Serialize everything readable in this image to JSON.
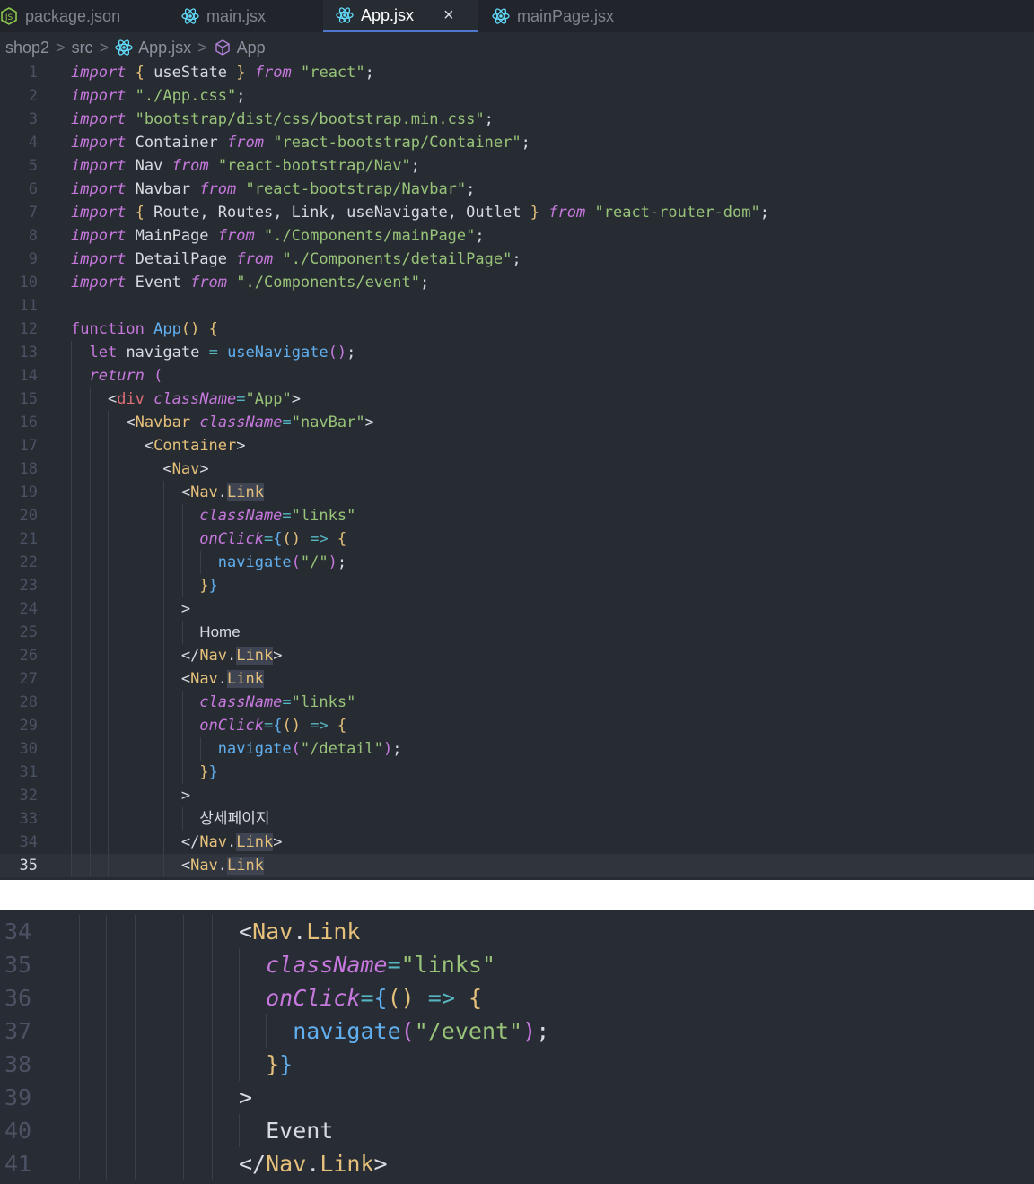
{
  "tabs": [
    {
      "label": "package.json",
      "icon": "nodejs-icon"
    },
    {
      "label": "main.jsx",
      "icon": "react-icon"
    },
    {
      "label": "App.jsx",
      "icon": "react-icon",
      "active": true,
      "close": "×"
    },
    {
      "label": "mainPage.jsx",
      "icon": "react-icon"
    }
  ],
  "breadcrumb": {
    "parts": [
      "shop2",
      "src",
      "App.jsx",
      "App"
    ],
    "separator": ">"
  },
  "editor_top": {
    "current_line": 35,
    "lines": [
      {
        "n": "1",
        "tokens": [
          [
            "kw",
            "import"
          ],
          [
            "plain",
            " "
          ],
          [
            "brk1",
            "{"
          ],
          [
            "plain",
            " useState "
          ],
          [
            "brk1",
            "}"
          ],
          [
            "plain",
            " "
          ],
          [
            "kw",
            "from"
          ],
          [
            "plain",
            " "
          ],
          [
            "str",
            "\"react\""
          ],
          [
            "plain",
            ";"
          ]
        ]
      },
      {
        "n": "2",
        "tokens": [
          [
            "kw",
            "import"
          ],
          [
            "plain",
            " "
          ],
          [
            "str",
            "\"./App.css\""
          ],
          [
            "plain",
            ";"
          ]
        ]
      },
      {
        "n": "3",
        "tokens": [
          [
            "kw",
            "import"
          ],
          [
            "plain",
            " "
          ],
          [
            "str",
            "\"bootstrap/dist/css/bootstrap.min.css\""
          ],
          [
            "plain",
            ";"
          ]
        ]
      },
      {
        "n": "4",
        "tokens": [
          [
            "kw",
            "import"
          ],
          [
            "plain",
            " Container "
          ],
          [
            "kw",
            "from"
          ],
          [
            "plain",
            " "
          ],
          [
            "str",
            "\"react-bootstrap/Container\""
          ],
          [
            "plain",
            ";"
          ]
        ]
      },
      {
        "n": "5",
        "tokens": [
          [
            "kw",
            "import"
          ],
          [
            "plain",
            " Nav "
          ],
          [
            "kw",
            "from"
          ],
          [
            "plain",
            " "
          ],
          [
            "str",
            "\"react-bootstrap/Nav\""
          ],
          [
            "plain",
            ";"
          ]
        ]
      },
      {
        "n": "6",
        "tokens": [
          [
            "kw",
            "import"
          ],
          [
            "plain",
            " Navbar "
          ],
          [
            "kw",
            "from"
          ],
          [
            "plain",
            " "
          ],
          [
            "str",
            "\"react-bootstrap/Navbar\""
          ],
          [
            "plain",
            ";"
          ]
        ]
      },
      {
        "n": "7",
        "tokens": [
          [
            "kw",
            "import"
          ],
          [
            "plain",
            " "
          ],
          [
            "brk1",
            "{"
          ],
          [
            "plain",
            " Route, Routes, Link, useNavigate, Outlet "
          ],
          [
            "brk1",
            "}"
          ],
          [
            "plain",
            " "
          ],
          [
            "kw",
            "from"
          ],
          [
            "plain",
            " "
          ],
          [
            "str",
            "\"react-router-dom\""
          ],
          [
            "plain",
            ";"
          ]
        ]
      },
      {
        "n": "8",
        "tokens": [
          [
            "kw",
            "import"
          ],
          [
            "plain",
            " MainPage "
          ],
          [
            "kw",
            "from"
          ],
          [
            "plain",
            " "
          ],
          [
            "str",
            "\"./Components/mainPage\""
          ],
          [
            "plain",
            ";"
          ]
        ]
      },
      {
        "n": "9",
        "tokens": [
          [
            "kw",
            "import"
          ],
          [
            "plain",
            " DetailPage "
          ],
          [
            "kw",
            "from"
          ],
          [
            "plain",
            " "
          ],
          [
            "str",
            "\"./Components/detailPage\""
          ],
          [
            "plain",
            ";"
          ]
        ]
      },
      {
        "n": "10",
        "tokens": [
          [
            "kw",
            "import"
          ],
          [
            "plain",
            " Event "
          ],
          [
            "kw",
            "from"
          ],
          [
            "plain",
            " "
          ],
          [
            "str",
            "\"./Components/event\""
          ],
          [
            "plain",
            ";"
          ]
        ]
      },
      {
        "n": "11",
        "tokens": []
      },
      {
        "n": "12",
        "tokens": [
          [
            "kwn",
            "function"
          ],
          [
            "plain",
            " "
          ],
          [
            "fn",
            "App"
          ],
          [
            "brk1",
            "()"
          ],
          [
            "plain",
            " "
          ],
          [
            "brk1",
            "{"
          ]
        ]
      },
      {
        "n": "13",
        "tokens": [
          [
            "plain",
            "  "
          ],
          [
            "kwn",
            "let"
          ],
          [
            "plain",
            " navigate "
          ],
          [
            "op",
            "="
          ],
          [
            "plain",
            " "
          ],
          [
            "fn",
            "useNavigate"
          ],
          [
            "brk2",
            "()"
          ],
          [
            "plain",
            ";"
          ]
        ]
      },
      {
        "n": "14",
        "tokens": [
          [
            "plain",
            "  "
          ],
          [
            "kw",
            "return"
          ],
          [
            "plain",
            " "
          ],
          [
            "brk2",
            "("
          ]
        ]
      },
      {
        "n": "15",
        "tokens": [
          [
            "plain",
            "    "
          ],
          [
            "plain",
            "<"
          ],
          [
            "tag",
            "div"
          ],
          [
            "plain",
            " "
          ],
          [
            "attr2",
            "className"
          ],
          [
            "op",
            "="
          ],
          [
            "str",
            "\"App\""
          ],
          [
            "plain",
            ">"
          ]
        ]
      },
      {
        "n": "16",
        "tokens": [
          [
            "plain",
            "      "
          ],
          [
            "plain",
            "<"
          ],
          [
            "comp",
            "Navbar"
          ],
          [
            "plain",
            " "
          ],
          [
            "attr2",
            "className"
          ],
          [
            "op",
            "="
          ],
          [
            "str",
            "\"navBar\""
          ],
          [
            "plain",
            ">"
          ]
        ]
      },
      {
        "n": "17",
        "tokens": [
          [
            "plain",
            "        "
          ],
          [
            "plain",
            "<"
          ],
          [
            "comp",
            "Container"
          ],
          [
            "plain",
            ">"
          ]
        ]
      },
      {
        "n": "18",
        "tokens": [
          [
            "plain",
            "          "
          ],
          [
            "plain",
            "<"
          ],
          [
            "comp",
            "Nav"
          ],
          [
            "plain",
            ">"
          ]
        ]
      },
      {
        "n": "19",
        "tokens": [
          [
            "plain",
            "            "
          ],
          [
            "plain",
            "<"
          ],
          [
            "comp",
            "Nav"
          ],
          [
            "plain",
            "."
          ],
          [
            "comp",
            "Link"
          ]
        ]
      },
      {
        "n": "20",
        "tokens": [
          [
            "plain",
            "              "
          ],
          [
            "attr2",
            "className"
          ],
          [
            "op",
            "="
          ],
          [
            "str",
            "\"links\""
          ]
        ]
      },
      {
        "n": "21",
        "tokens": [
          [
            "plain",
            "              "
          ],
          [
            "attr2",
            "onClick"
          ],
          [
            "op",
            "="
          ],
          [
            "brk3",
            "{"
          ],
          [
            "brk1",
            "()"
          ],
          [
            "plain",
            " "
          ],
          [
            "op",
            "=>"
          ],
          [
            "plain",
            " "
          ],
          [
            "brk1",
            "{"
          ]
        ]
      },
      {
        "n": "22",
        "tokens": [
          [
            "plain",
            "                "
          ],
          [
            "fn",
            "navigate"
          ],
          [
            "brk2",
            "("
          ],
          [
            "str",
            "\"/\""
          ],
          [
            "brk2",
            ")"
          ],
          [
            "plain",
            ";"
          ]
        ]
      },
      {
        "n": "23",
        "tokens": [
          [
            "plain",
            "              "
          ],
          [
            "brk1",
            "}"
          ],
          [
            "brk3",
            "}"
          ]
        ]
      },
      {
        "n": "24",
        "tokens": [
          [
            "plain",
            "            "
          ],
          [
            "plain",
            ">"
          ]
        ]
      },
      {
        "n": "25",
        "tokens": [
          [
            "plain",
            "              "
          ],
          [
            "txt",
            "Home"
          ]
        ]
      },
      {
        "n": "26",
        "tokens": [
          [
            "plain",
            "            "
          ],
          [
            "plain",
            "</"
          ],
          [
            "comp",
            "Nav"
          ],
          [
            "plain",
            "."
          ],
          [
            "comp",
            "Link"
          ],
          [
            "plain",
            ">"
          ]
        ]
      },
      {
        "n": "27",
        "tokens": [
          [
            "plain",
            "            "
          ],
          [
            "plain",
            "<"
          ],
          [
            "comp",
            "Nav"
          ],
          [
            "plain",
            "."
          ],
          [
            "comp",
            "Link"
          ]
        ]
      },
      {
        "n": "28",
        "tokens": [
          [
            "plain",
            "              "
          ],
          [
            "attr2",
            "className"
          ],
          [
            "op",
            "="
          ],
          [
            "str",
            "\"links\""
          ]
        ]
      },
      {
        "n": "29",
        "tokens": [
          [
            "plain",
            "              "
          ],
          [
            "attr2",
            "onClick"
          ],
          [
            "op",
            "="
          ],
          [
            "brk3",
            "{"
          ],
          [
            "brk1",
            "()"
          ],
          [
            "plain",
            " "
          ],
          [
            "op",
            "=>"
          ],
          [
            "plain",
            " "
          ],
          [
            "brk1",
            "{"
          ]
        ]
      },
      {
        "n": "30",
        "tokens": [
          [
            "plain",
            "                "
          ],
          [
            "fn",
            "navigate"
          ],
          [
            "brk2",
            "("
          ],
          [
            "str",
            "\"/detail\""
          ],
          [
            "brk2",
            ")"
          ],
          [
            "plain",
            ";"
          ]
        ]
      },
      {
        "n": "31",
        "tokens": [
          [
            "plain",
            "              "
          ],
          [
            "brk1",
            "}"
          ],
          [
            "brk3",
            "}"
          ]
        ]
      },
      {
        "n": "32",
        "tokens": [
          [
            "plain",
            "            "
          ],
          [
            "plain",
            ">"
          ]
        ]
      },
      {
        "n": "33",
        "tokens": [
          [
            "plain",
            "              "
          ],
          [
            "txt",
            "상세페이지"
          ]
        ]
      },
      {
        "n": "34",
        "tokens": [
          [
            "plain",
            "            "
          ],
          [
            "plain",
            "</"
          ],
          [
            "comp",
            "Nav"
          ],
          [
            "plain",
            "."
          ],
          [
            "comp",
            "Link"
          ],
          [
            "plain",
            ">"
          ]
        ]
      },
      {
        "n": "35",
        "tokens": [
          [
            "plain",
            "            "
          ],
          [
            "plain",
            "<"
          ],
          [
            "comp",
            "Nav"
          ],
          [
            "plain",
            "."
          ],
          [
            "comp",
            "Link"
          ]
        ]
      }
    ]
  },
  "editor_bottom": {
    "lines": [
      {
        "n": "34",
        "tokens": [
          [
            "plain",
            "<"
          ],
          [
            "comp",
            "Nav"
          ],
          [
            "plain",
            "."
          ],
          [
            "comp",
            "Link"
          ]
        ]
      },
      {
        "n": "35",
        "tokens": [
          [
            "plain",
            "  "
          ],
          [
            "attr2",
            "className"
          ],
          [
            "op",
            "="
          ],
          [
            "str",
            "\"links\""
          ]
        ]
      },
      {
        "n": "36",
        "tokens": [
          [
            "plain",
            "  "
          ],
          [
            "attr2",
            "onClick"
          ],
          [
            "op",
            "="
          ],
          [
            "brk3",
            "{"
          ],
          [
            "brk1",
            "()"
          ],
          [
            "plain",
            " "
          ],
          [
            "op",
            "=>"
          ],
          [
            "plain",
            " "
          ],
          [
            "brk1",
            "{"
          ]
        ]
      },
      {
        "n": "37",
        "tokens": [
          [
            "plain",
            "    "
          ],
          [
            "fn",
            "navigate"
          ],
          [
            "brk2",
            "("
          ],
          [
            "str",
            "\"/event\""
          ],
          [
            "brk2",
            ")"
          ],
          [
            "plain",
            ";"
          ]
        ]
      },
      {
        "n": "38",
        "tokens": [
          [
            "plain",
            "  "
          ],
          [
            "brk1",
            "}"
          ],
          [
            "brk3",
            "}"
          ]
        ]
      },
      {
        "n": "39",
        "tokens": [
          [
            "plain",
            ">"
          ]
        ]
      },
      {
        "n": "40",
        "tokens": [
          [
            "plain",
            "  Event"
          ]
        ]
      },
      {
        "n": "41",
        "tokens": [
          [
            "plain",
            "</"
          ],
          [
            "comp",
            "Nav"
          ],
          [
            "plain",
            "."
          ],
          [
            "comp",
            "Link"
          ],
          [
            "plain",
            ">"
          ]
        ]
      }
    ]
  }
}
